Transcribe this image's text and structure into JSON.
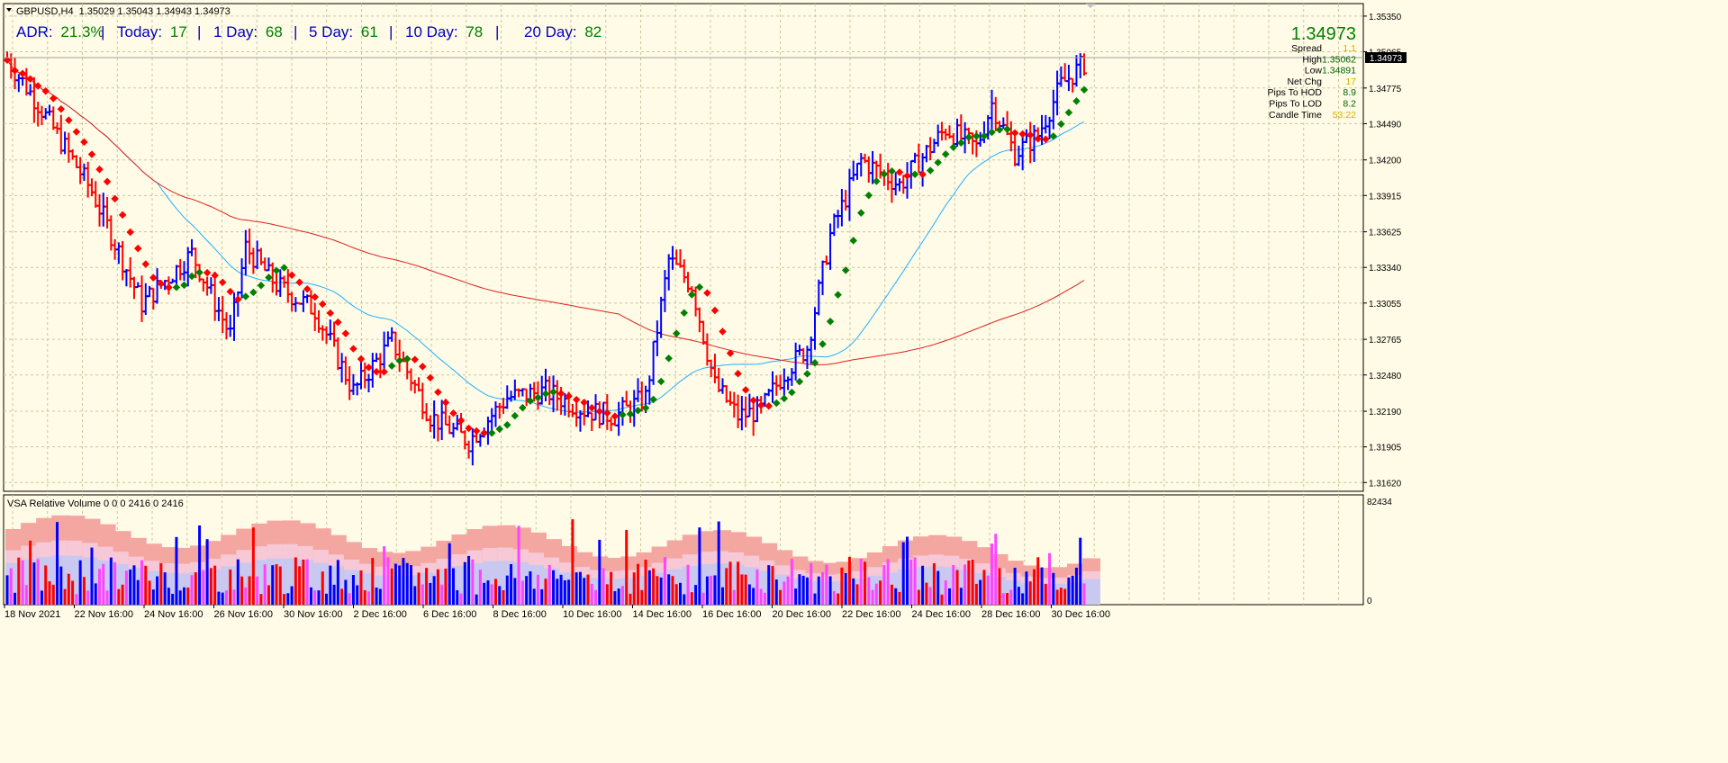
{
  "header": {
    "symbol": "GBPUSD,H4",
    "ohlc": "1.35029 1.35043 1.34943 1.34973"
  },
  "adr": {
    "label": "ADR:",
    "value": "21.3%",
    "items": [
      {
        "label": "Today:",
        "value": "17"
      },
      {
        "label": "1 Day:",
        "value": "68"
      },
      {
        "label": "5 Day:",
        "value": "61"
      },
      {
        "label": "10 Day:",
        "value": "78"
      },
      {
        "label": "20 Day:",
        "value": "82"
      }
    ]
  },
  "info_panel": {
    "price": "1.34973",
    "rows": [
      {
        "label": "Spread",
        "value": "1.1",
        "color": "#d4b000"
      },
      {
        "label": "High",
        "value": "1.35062",
        "color": "#006400"
      },
      {
        "label": "Low",
        "value": "1.34891",
        "color": "#006400"
      },
      {
        "label": "Net Chg",
        "value": "17",
        "color": "#d4b000"
      },
      {
        "label": "Pips To HOD",
        "value": "8.9",
        "color": "#006400"
      },
      {
        "label": "Pips To LOD",
        "value": "8.2",
        "color": "#006400"
      },
      {
        "label": "Candle Time",
        "value": "53:22",
        "color": "#d4b000"
      }
    ]
  },
  "price_axis": {
    "ticks": [
      "1.35350",
      "1.35065",
      "1.34775",
      "1.34490",
      "1.34200",
      "1.33915",
      "1.33625",
      "1.33340",
      "1.33055",
      "1.32765",
      "1.32480",
      "1.32190",
      "1.31905",
      "1.31620"
    ],
    "current_label": "1.34973"
  },
  "time_axis": {
    "labels": [
      "18 Nov 2021",
      "22 Nov 16:00",
      "24 Nov 16:00",
      "26 Nov 16:00",
      "30 Nov 16:00",
      "2 Dec 16:00",
      "6 Dec 16:00",
      "8 Dec 16:00",
      "10 Dec 16:00",
      "14 Dec 16:00",
      "16 Dec 16:00",
      "20 Dec 16:00",
      "22 Dec 16:00",
      "24 Dec 16:00",
      "28 Dec 16:00",
      "30 Dec 16:00"
    ]
  },
  "volume_panel": {
    "title": "VSA Relative Volume 0 0 0 2416 0 2416",
    "max_label": "82434",
    "min_label": "0"
  },
  "colors": {
    "background": "#fffbe6",
    "grid": "#c8c8a0",
    "bull_bar": "#0000ff",
    "bear_bar": "#ff0000",
    "ma_red": "#e02020",
    "ma_blue": "#20b0ff",
    "dots_up": "#008000",
    "dots_down": "#ff0000",
    "adr_text": "#0000c0",
    "adr_value": "#008000"
  },
  "chart_data": {
    "type": "bar",
    "price_range": [
      1.3155,
      1.3545
    ],
    "current_price": 1.34973,
    "volume_range": [
      0,
      82434
    ],
    "series": [
      {
        "name": "GBPUSD H4",
        "values": "ohlc"
      }
    ]
  }
}
